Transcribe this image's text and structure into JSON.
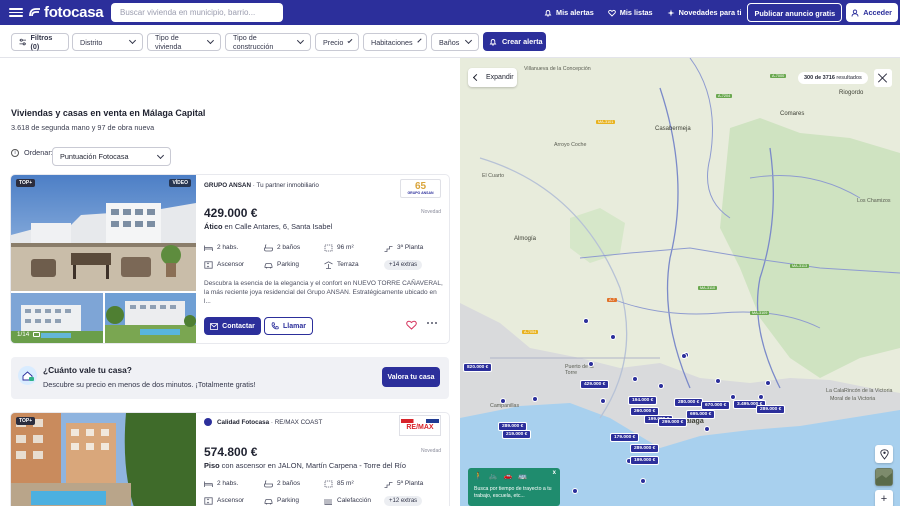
{
  "header": {
    "brand": "fotocasa",
    "search_placeholder": "Buscar vivienda en municipio, barrio...",
    "links": [
      "Mis alertas",
      "Mis listas",
      "Novedades para ti"
    ],
    "publish": "Publicar anuncio gratis",
    "login": "Acceder"
  },
  "filters": {
    "filters_label": "Filtros (0)",
    "chips": [
      "Distrito",
      "Tipo de vivienda",
      "Tipo de construcción",
      "Precio",
      "Habitaciones",
      "Baños"
    ],
    "create_alert": "Crear alerta"
  },
  "results": {
    "title": "Viviendas y casas en venta en Málaga Capital",
    "subtitle": "3.618 de segunda mano y 97 de obra nueva",
    "order_label": "Ordenar:",
    "order_value": "Puntuación Fotocasa"
  },
  "listings": [
    {
      "badge": "TOP+",
      "video_badge": "VÍDEO",
      "photo_count": "1/14",
      "agency": "GRUPO ANSAN",
      "agency_tagline": "· Tu partner inmobiliario",
      "agency_logo_num": "65",
      "agency_logo_name": "GRUPO ANSAN",
      "tag": "Novedad",
      "price": "429.000 €",
      "type": "Ático",
      "address": "en Calle Antares, 6, Santa Isabel",
      "features": [
        "2 habs.",
        "2 baños",
        "96 m²",
        "3ª Planta",
        "Ascensor",
        "Parking",
        "Terraza"
      ],
      "extras": "+14 extras",
      "description": "Descubra la esencia de la elegancia y el confort en NUEVO TORRE CAÑAVERAL, la más reciente joya residencial del Grupo ANSAN. Estratégicamente ubicado en l...",
      "contact": "Contactar",
      "call": "Llamar"
    },
    {
      "badge": "TOP+",
      "agency": "Calidad Fotocasa",
      "agency_tagline": "· RE/MAX COAST",
      "agency_logo_name": "RE/MAX",
      "tag": "Novedad",
      "price": "574.800 €",
      "type": "Piso",
      "address": "con ascensor en JALON, Martín Carpena - Torre del Río",
      "features": [
        "2 habs.",
        "2 baños",
        "85 m²",
        "5ª Planta",
        "Ascensor",
        "Parking",
        "Calefacción"
      ],
      "extras": "+12 extras"
    }
  ],
  "valuation": {
    "title": "¿Cuánto vale tu casa?",
    "subtitle": "Descubre su precio en menos de dos minutos. ¡Totalmente gratis!",
    "button": "Valora tu casa"
  },
  "map": {
    "expand": "Expandir",
    "count_bold": "300 de 3716",
    "count_rest": "resultados",
    "places": [
      "Villanueva de la Concepción",
      "Casabermeja",
      "Arroyo Coche",
      "El Cuarto",
      "Comares",
      "Riogordo",
      "Almogía",
      "Los Chamizos",
      "Puerto de la Torre",
      "Campanillas",
      "Málaga",
      "La Cala",
      "Rincón de la Victoria",
      "Moral de la Victoria",
      "Aeropuerto"
    ],
    "price_tags": [
      "820.000 €",
      "429.000 €",
      "194.000 €",
      "280.000 €",
      "199.000 €",
      "670.000 €",
      "3.495.000 €",
      "289.000 €",
      "289.000 €",
      "219.000 €",
      "179.000 €",
      "289.000 €",
      "199.000 €",
      "299.000 €",
      "695.000 €",
      "260.000 €"
    ],
    "travel_text": "Busca por tiempo de trayecto a tu trabajo, escuela, etc..."
  }
}
